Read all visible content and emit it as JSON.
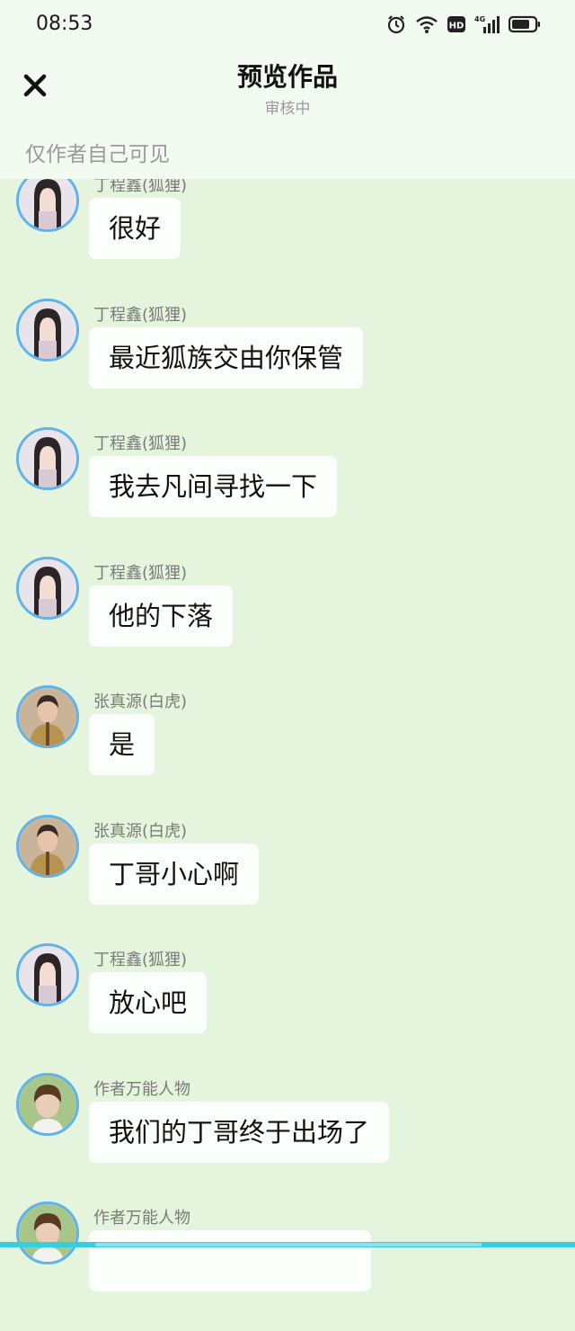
{
  "status_bar": {
    "time": "08:53"
  },
  "header": {
    "title": "预览作品",
    "subtitle": "审核中",
    "visibility_note": "仅作者自己可见"
  },
  "messages": [
    {
      "sender": "丁程鑫(狐狸)",
      "text": "很好",
      "avatar": "fox"
    },
    {
      "sender": "丁程鑫(狐狸)",
      "text": "最近狐族交由你保管",
      "avatar": "fox"
    },
    {
      "sender": "丁程鑫(狐狸)",
      "text": "我去凡间寻找一下",
      "avatar": "fox"
    },
    {
      "sender": "丁程鑫(狐狸)",
      "text": "他的下落",
      "avatar": "fox"
    },
    {
      "sender": "张真源(白虎)",
      "text": "是",
      "avatar": "tiger"
    },
    {
      "sender": "张真源(白虎)",
      "text": "丁哥小心啊",
      "avatar": "tiger"
    },
    {
      "sender": "丁程鑫(狐狸)",
      "text": "放心吧",
      "avatar": "fox"
    },
    {
      "sender": "作者万能人物",
      "text": "我们的丁哥终于出场了",
      "avatar": "author"
    },
    {
      "sender": "作者万能人物",
      "text": "",
      "avatar": "author"
    }
  ],
  "colors": {
    "chat_background": "#e5f4dc",
    "header_background": "#f2fbf0",
    "avatar_ring": "#5db3ea",
    "bubble": "#fbfffb"
  }
}
